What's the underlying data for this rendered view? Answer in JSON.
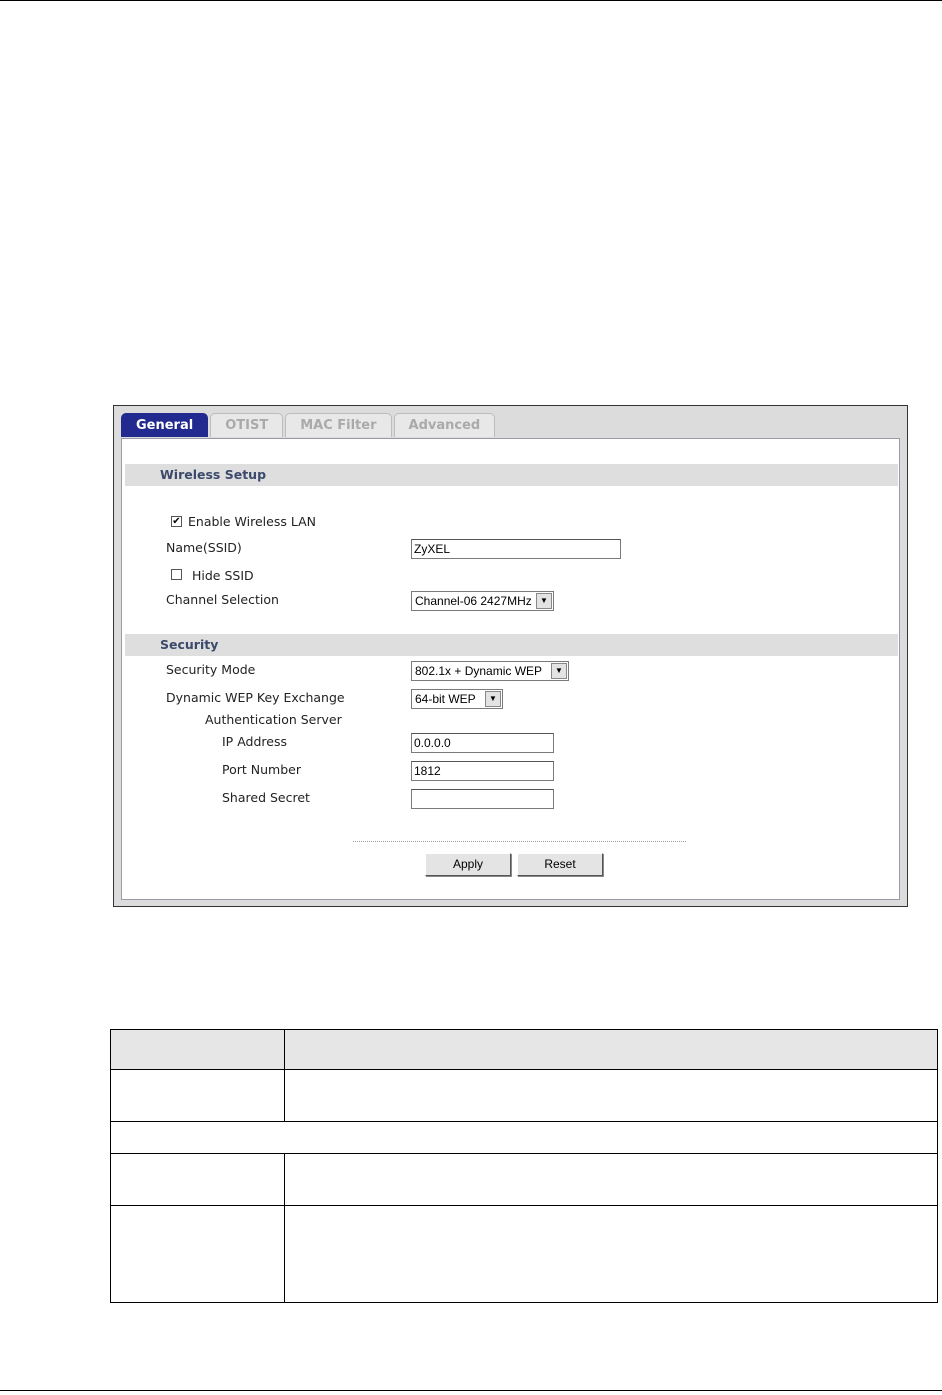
{
  "tabs": [
    {
      "label": "General",
      "active": true
    },
    {
      "label": "OTIST",
      "active": false
    },
    {
      "label": "MAC Filter",
      "active": false
    },
    {
      "label": "Advanced",
      "active": false
    }
  ],
  "wireless_setup": {
    "title": "Wireless Setup",
    "enable_wireless_lan": {
      "label": "Enable Wireless LAN",
      "checked": true
    },
    "ssid": {
      "label": "Name(SSID)",
      "value": "ZyXEL"
    },
    "hide_ssid": {
      "label": "Hide SSID",
      "checked": false
    },
    "channel": {
      "label": "Channel Selection",
      "value": "Channel-06 2427MHz"
    }
  },
  "security": {
    "title": "Security",
    "mode": {
      "label": "Security Mode",
      "value": "802.1x + Dynamic WEP"
    },
    "wep_key_exchange": {
      "label": "Dynamic WEP Key Exchange",
      "value": "64-bit WEP"
    },
    "auth_server_label": "Authentication Server",
    "ip_address": {
      "label": "IP Address",
      "value": "0.0.0.0"
    },
    "port_number": {
      "label": "Port Number",
      "value": "1812"
    },
    "shared_secret": {
      "label": "Shared Secret",
      "value": ""
    }
  },
  "buttons": {
    "apply": "Apply",
    "reset": "Reset"
  },
  "icons": {
    "checkbox_check": "check-icon",
    "dropdown_arrow": "chevron-down-icon"
  },
  "colors": {
    "active_tab": "#232a8f",
    "section_bar": "#dedede",
    "section_text": "#3b4a6b"
  }
}
